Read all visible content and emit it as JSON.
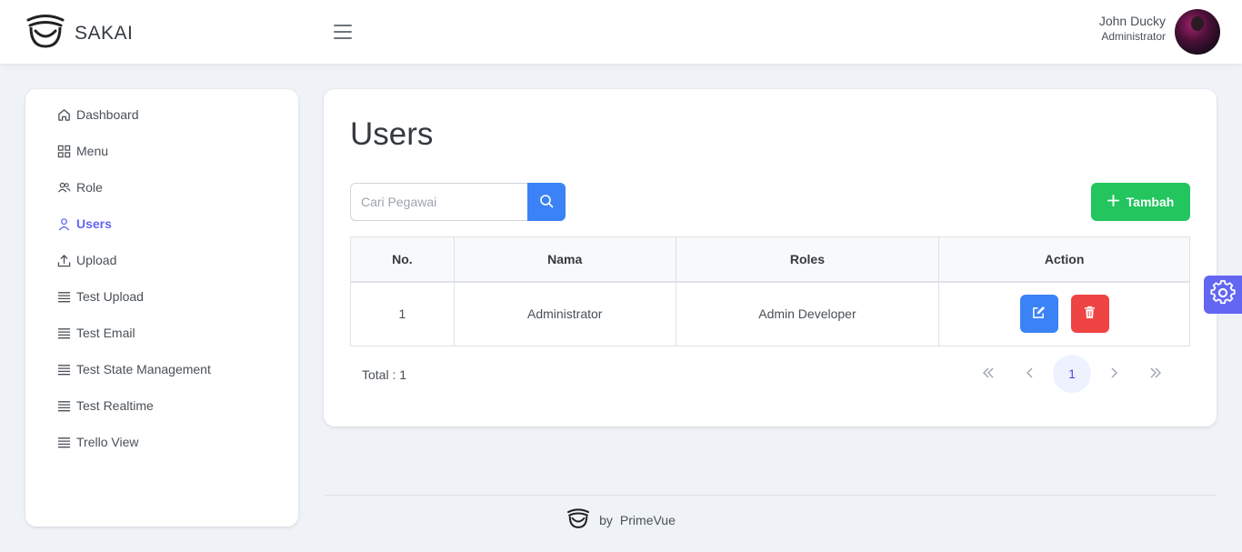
{
  "header": {
    "logo_text": "SAKAI",
    "user_name": "John Ducky",
    "user_role": "Administrator"
  },
  "sidebar": {
    "items": [
      {
        "label": "Dashboard",
        "icon": "home-icon"
      },
      {
        "label": "Menu",
        "icon": "th-large-icon"
      },
      {
        "label": "Role",
        "icon": "users-icon"
      },
      {
        "label": "Users",
        "icon": "user-icon",
        "active": true
      },
      {
        "label": "Upload",
        "icon": "upload-icon"
      },
      {
        "label": "Test Upload",
        "icon": "align-justify-icon"
      },
      {
        "label": "Test Email",
        "icon": "align-justify-icon"
      },
      {
        "label": "Test State Management",
        "icon": "align-justify-icon"
      },
      {
        "label": "Test Realtime",
        "icon": "align-justify-icon"
      },
      {
        "label": "Trello View",
        "icon": "align-justify-icon"
      }
    ]
  },
  "main": {
    "title": "Users",
    "search": {
      "placeholder": "Cari Pegawai",
      "value": ""
    },
    "add_label": "Tambah",
    "table": {
      "headers": [
        "No.",
        "Nama",
        "Roles",
        "Action"
      ],
      "rows": [
        {
          "no": "1",
          "nama": "Administrator",
          "roles": "Admin Developer"
        }
      ]
    },
    "total_label": "Total : 1",
    "pagination": {
      "current_page": "1",
      "first": "«",
      "prev": "‹",
      "next": "›",
      "last": "»"
    }
  },
  "footer": {
    "by": "by",
    "brand": "PrimeVue"
  },
  "colors": {
    "primary": "#6366f1",
    "search_button": "#3b82f6",
    "add_button": "#22c55e",
    "delete_button": "#ef4444",
    "edit_button": "#3b82f6"
  }
}
